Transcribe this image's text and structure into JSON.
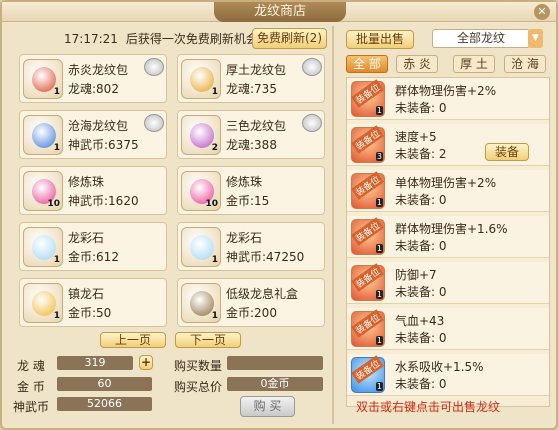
{
  "window": {
    "title": "龙纹商店",
    "close_icon": "close-icon"
  },
  "left": {
    "timer": "17:17:21",
    "timer_text": "后获得一次免费刷新机会",
    "refresh_label": "免费刷新(2)",
    "items": [
      {
        "name": "赤炎龙纹包",
        "price": "龙魂:802",
        "count": "1",
        "color": "#d9482b",
        "badge": true
      },
      {
        "name": "厚土龙纹包",
        "price": "龙魂:735",
        "count": "1",
        "color": "#e6a21d",
        "badge": true
      },
      {
        "name": "沧海龙纹包",
        "price": "神武币:6375",
        "count": "1",
        "color": "#3d79d9",
        "badge": true
      },
      {
        "name": "三色龙纹包",
        "price": "龙魂:388",
        "count": "2",
        "color": "#b94fc0",
        "badge": true
      },
      {
        "name": "修炼珠",
        "price": "神武币:1620",
        "count": "10",
        "color": "#e83a8f",
        "badge": false
      },
      {
        "name": "修炼珠",
        "price": "金币:15",
        "count": "10",
        "color": "#e83a8f",
        "badge": false
      },
      {
        "name": "龙彩石",
        "price": "金币:612",
        "count": "1",
        "color": "#9fd6f2",
        "badge": false
      },
      {
        "name": "龙彩石",
        "price": "神武币:47250",
        "count": "1",
        "color": "#9fd6f2",
        "badge": false
      },
      {
        "name": "镇龙石",
        "price": "金币:50",
        "count": "1",
        "color": "#f0b42c",
        "badge": false
      },
      {
        "name": "低级龙息礼盒",
        "price": "金币:200",
        "count": "1",
        "color": "#8a6a3a",
        "badge": false
      }
    ],
    "prev_label": "上一页",
    "next_label": "下一页",
    "currency": [
      {
        "label": "龙 魂",
        "value": "319"
      },
      {
        "label": "金 币",
        "value": "60"
      },
      {
        "label": "神武币",
        "value": "52066"
      }
    ],
    "plus_icon": "plus-icon",
    "buy_qty_label": "购买数量",
    "buy_qty_value": "",
    "buy_total_label": "购买总价",
    "buy_total_value": "0金币",
    "buy_label": "购 买"
  },
  "right": {
    "batch_sell_label": "批量出售",
    "filter_value": "全部龙纹",
    "tabs": [
      "全 部",
      "赤 炎",
      "厚 土",
      "沧 海"
    ],
    "active_tab": 0,
    "list": [
      {
        "tag": "装备位",
        "attr": "群体物理伤害+2%",
        "equip": "未装备: 0",
        "count": "1",
        "blue": false,
        "button": ""
      },
      {
        "tag": "装备位",
        "attr": "速度+5",
        "equip": "未装备: 2",
        "count": "3",
        "blue": false,
        "button": "装备"
      },
      {
        "tag": "装备位",
        "attr": "单体物理伤害+2%",
        "equip": "未装备: 0",
        "count": "1",
        "blue": false,
        "button": ""
      },
      {
        "tag": "装备位",
        "attr": "群体物理伤害+1.6%",
        "equip": "未装备: 0",
        "count": "1",
        "blue": false,
        "button": ""
      },
      {
        "tag": "装备位",
        "attr": "防御+7",
        "equip": "未装备: 0",
        "count": "1",
        "blue": false,
        "button": ""
      },
      {
        "tag": "装备位",
        "attr": "气血+43",
        "equip": "未装备: 0",
        "count": "1",
        "blue": false,
        "button": ""
      },
      {
        "tag": "装备位",
        "attr": "水系吸收+1.5%",
        "equip": "未装备: 0",
        "count": "1",
        "blue": true,
        "button": ""
      }
    ],
    "hint": "双击或右键点击可出售龙纹"
  }
}
